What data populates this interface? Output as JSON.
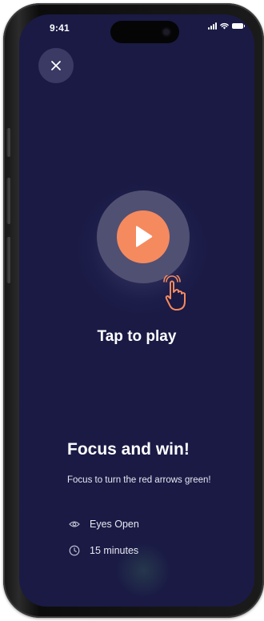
{
  "status_bar": {
    "time": "9:41"
  },
  "player": {
    "cta_label": "Tap to play",
    "icons": {
      "close": "close-icon",
      "play": "play-icon",
      "hand": "tap-hand-icon"
    },
    "colors": {
      "screen_background": "#1a1a45",
      "play_button": "#f58a5e",
      "play_ring": "#505073",
      "close_button": "#3a3a64"
    }
  },
  "session": {
    "title": "Focus and win!",
    "description": "Focus to turn the red arrows green!",
    "details": [
      {
        "icon": "eye-icon",
        "label": "Eyes Open"
      },
      {
        "icon": "clock-icon",
        "label": "15 minutes"
      }
    ]
  }
}
